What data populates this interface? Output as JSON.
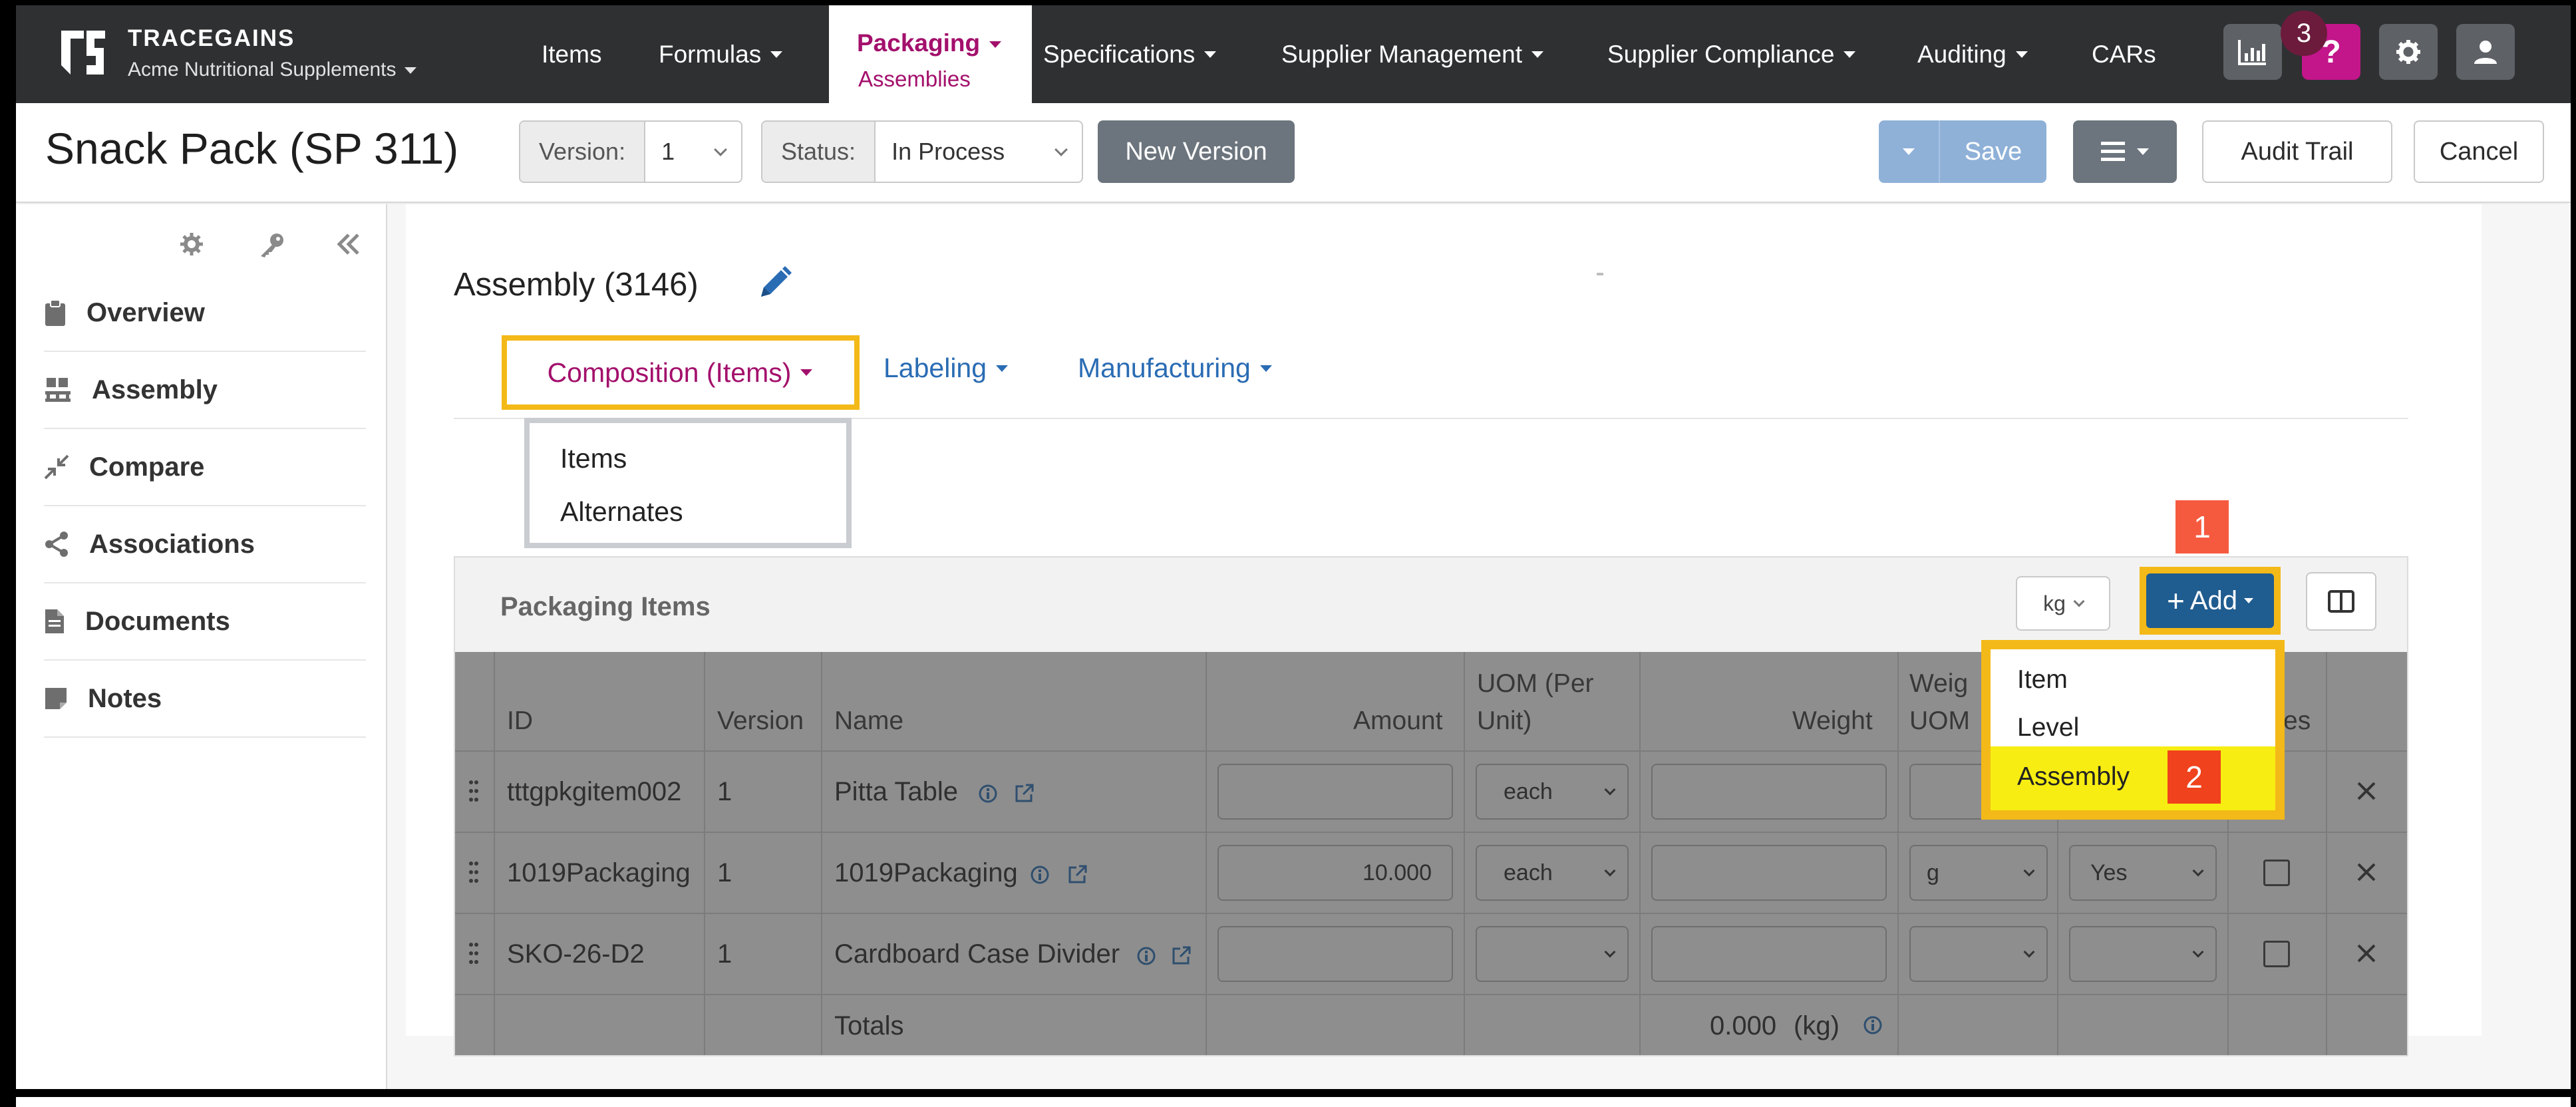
{
  "brand": {
    "name": "TRACEGAINS",
    "org": "Acme Nutritional Supplements"
  },
  "nav": {
    "items": "Items",
    "formulas": "Formulas",
    "packaging": "Packaging",
    "packaging_sub": "Assemblies",
    "specifications": "Specifications",
    "supplier_management": "Supplier Management",
    "supplier_compliance": "Supplier Compliance",
    "auditing": "Auditing",
    "cars": "CARs",
    "badge": "3"
  },
  "header": {
    "title": "Snack Pack (SP 311)",
    "version_label": "Version:",
    "version_value": "1",
    "status_label": "Status:",
    "status_value": "In Process",
    "new_version": "New Version",
    "save": "Save",
    "audit_trail": "Audit Trail",
    "cancel": "Cancel"
  },
  "sidebar": {
    "items": [
      {
        "label": "Overview",
        "icon": "clipboard-icon"
      },
      {
        "label": "Assembly",
        "icon": "pallet-icon"
      },
      {
        "label": "Compare",
        "icon": "compress-icon"
      },
      {
        "label": "Associations",
        "icon": "share-icon"
      },
      {
        "label": "Documents",
        "icon": "file-icon"
      },
      {
        "label": "Notes",
        "icon": "note-icon"
      }
    ]
  },
  "assembly": {
    "title": "Assembly (3146)",
    "tabs": {
      "composition": "Composition (Items)",
      "labeling": "Labeling",
      "manufacturing": "Manufacturing"
    },
    "composition_menu": [
      "Items",
      "Alternates"
    ]
  },
  "panel": {
    "title": "Packaging Items",
    "uom": "kg",
    "add": "Add",
    "add_menu": [
      "Item",
      "Level",
      "Assembly"
    ],
    "callout_1": "1",
    "callout_2": "2"
  },
  "table": {
    "headers": {
      "id": "ID",
      "version": "Version",
      "name": "Name",
      "amount": "Amount",
      "uom_line1": "UOM (Per",
      "uom_line2": "Unit)",
      "weight": "Weight",
      "weight_uom_line1": "Weig",
      "weight_uom_line2": "UOM",
      "notes_tail": "es"
    },
    "rows": [
      {
        "id": "tttgpkgitem002",
        "version": "1",
        "name": "Pitta Table",
        "amount": "",
        "uom": "each",
        "weight": "",
        "weight_uom": "",
        "flag": ""
      },
      {
        "id": "1019Packaging",
        "version": "1",
        "name": "1019Packaging",
        "amount": "10.000",
        "uom": "each",
        "weight": "",
        "weight_uom": "g",
        "flag": "Yes"
      },
      {
        "id": "SKO-26-D2",
        "version": "1",
        "name": "Cardboard Case Divider",
        "amount": "",
        "uom": "",
        "weight": "",
        "weight_uom": "",
        "flag": ""
      }
    ],
    "totals_label": "Totals",
    "totals_value": "0.000",
    "totals_unit": "(kg)"
  },
  "colors": {
    "accent": "#a3106c",
    "highlight": "#f3b918",
    "link": "#2a6cb4",
    "add_button": "#1f5c8f"
  }
}
